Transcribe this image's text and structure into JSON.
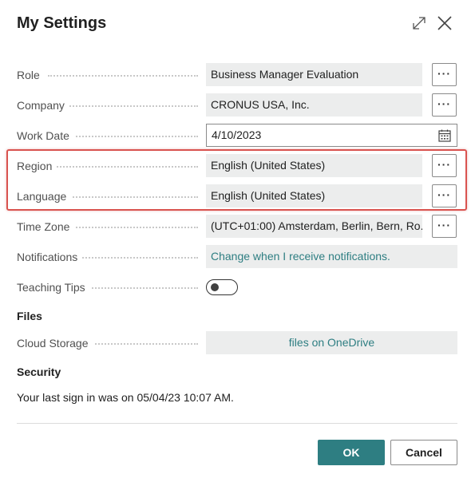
{
  "dialog": {
    "title": "My Settings"
  },
  "fields": {
    "role": {
      "label": "Role",
      "value": "Business Manager Evaluation"
    },
    "company": {
      "label": "Company",
      "value": "CRONUS USA, Inc."
    },
    "work_date": {
      "label": "Work Date",
      "value": "4/10/2023"
    },
    "region": {
      "label": "Region",
      "value": "English (United States)"
    },
    "language": {
      "label": "Language",
      "value": "English (United States)"
    },
    "time_zone": {
      "label": "Time Zone",
      "value": "(UTC+01:00) Amsterdam, Berlin, Bern, Ro..."
    },
    "notifications": {
      "label": "Notifications",
      "value": "Change when I receive notifications."
    },
    "teaching_tips": {
      "label": "Teaching Tips",
      "enabled": false
    }
  },
  "files": {
    "heading": "Files",
    "cloud_storage": {
      "label": "Cloud Storage",
      "value": "files on OneDrive"
    }
  },
  "security": {
    "heading": "Security",
    "last_sign_in": "Your last sign in was on 05/04/23 10:07 AM."
  },
  "buttons": {
    "ok": "OK",
    "cancel": "Cancel",
    "ellipsis": "···"
  },
  "icons": {
    "expand": "expand-icon",
    "close": "close-icon",
    "calendar": "calendar-icon"
  },
  "colors": {
    "accent": "#2e7e82",
    "highlight": "#d9534f",
    "field_bg": "#eceded"
  }
}
